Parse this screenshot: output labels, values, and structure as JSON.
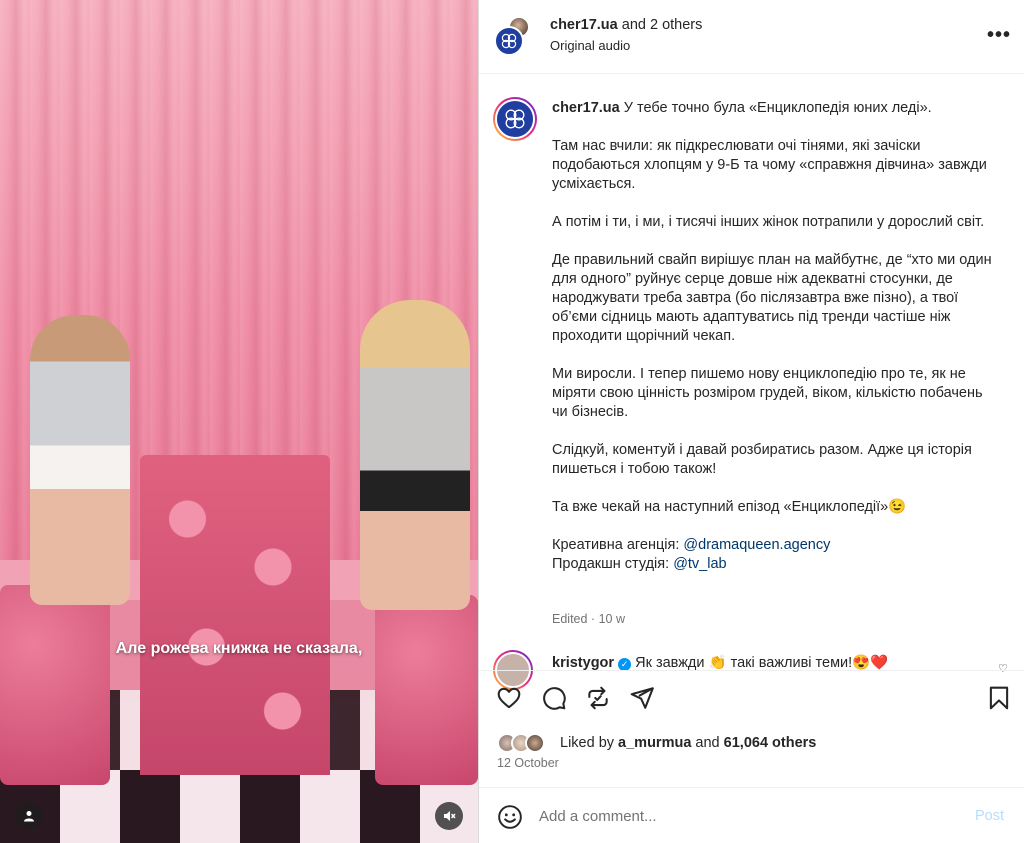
{
  "media": {
    "subtitle": "Але рожева книжка не сказала,",
    "tag_icon": "person-icon",
    "mute_icon": "speaker-muted-icon"
  },
  "header": {
    "username": "cher17.ua",
    "collab_suffix": "and 2 others",
    "audio": "Original audio",
    "more_icon": "•••"
  },
  "caption": {
    "username": "cher17.ua",
    "lines": [
      "У тебе точно була «Енциклопедія юних леді».",
      "Там нас вчили: як підкреслювати очі тінями, які зачіски подобаються хлопцям у 9-Б та чому «справжня дівчина» завжди усміхається.",
      "А потім і ти, і ми, і тисячі інших жінок потрапили у дорослий світ.",
      "Де правильний свайп вирішує план на майбутнє, де “хто ми один для одного” руйнує серце довше ніж адекватні стосунки, де народжувати треба завтра (бо післязавтра вже пізно), а твої об’єми сідниць мають адаптуватись під тренди частіше ніж проходити щорічний чекап.",
      "Ми виросли. І тепер пишемо нову енциклопедію про те, як не міряти свою цінність розміром грудей, віком, кількістю побачень чи бізнесів.",
      "Слідкуй, коментуй і давай розбиратись разом. Адже ця історія пишеться і тобою також!",
      "Та вже чекай на наступний епізод «Енциклопедії»😉"
    ],
    "agency_label": "Креативна агенція:",
    "agency_link": "@dramaqueen.agency",
    "studio_label": "Продакшн студія:",
    "studio_link": "@tv_lab",
    "edited": "Edited",
    "age": "10 w"
  },
  "comment": {
    "username": "kristygor",
    "text": "Як завжди 👏 такі важливі теми!😍❤️"
  },
  "likes": {
    "prefix": "Liked by",
    "user": "a_murmua",
    "joiner": "and",
    "count": "61,064 others"
  },
  "date": "12 October",
  "composer": {
    "placeholder": "Add a comment...",
    "post_label": "Post"
  },
  "colors": {
    "link": "#00376b",
    "post_disabled": "#b2dffc",
    "brand_avatar": "#1f3ea0"
  }
}
